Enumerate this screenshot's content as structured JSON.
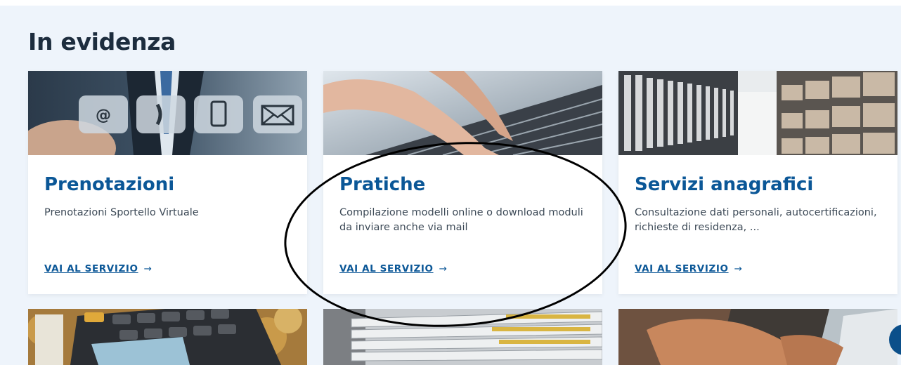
{
  "section": {
    "heading": "In evidenza"
  },
  "cards": [
    {
      "title": "Prenotazioni",
      "description": "Prenotazioni Sportello Virtuale",
      "link_label": "VAI AL SERVIZIO",
      "link_arrow": "→",
      "image_icons": [
        "at-sign-icon",
        "phone-icon",
        "mobile-icon",
        "envelope-icon"
      ]
    },
    {
      "title": "Pratiche",
      "description": "Compilazione modelli online o download moduli da inviare anche via mail",
      "link_label": "VAI AL SERVIZIO",
      "link_arrow": "→"
    },
    {
      "title": "Servizi anagrafici",
      "description": "Consultazione dati personali, autocertificazioni, richieste di residenza, ...",
      "link_label": "VAI AL SERVIZIO",
      "link_arrow": "→"
    }
  ],
  "bottom_cards": [
    {
      "image": "calculator-and-coins"
    },
    {
      "image": "stacked-files"
    },
    {
      "image": "hands-on-laptop"
    }
  ],
  "colors": {
    "section_bg": "#eef4fb",
    "heading": "#1d2d3e",
    "title": "#0b5797",
    "link": "#0b5797",
    "text": "#3d4a57"
  }
}
